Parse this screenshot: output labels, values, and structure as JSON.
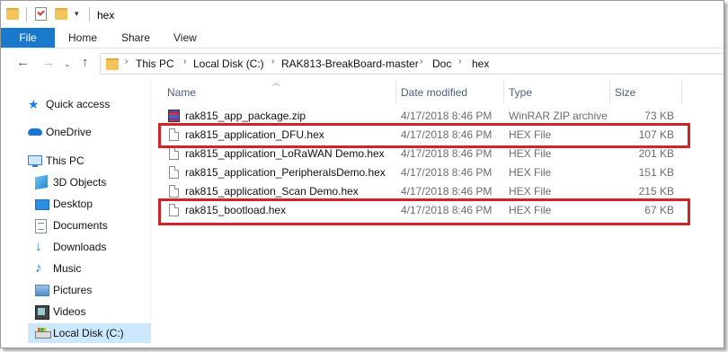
{
  "window": {
    "title": "hex"
  },
  "ribbon": {
    "tabs": [
      "File",
      "Home",
      "Share",
      "View"
    ]
  },
  "address": {
    "crumbs": [
      "This PC",
      "Local Disk (C:)",
      "RAK813-BreakBoard-master",
      "Doc",
      "hex"
    ]
  },
  "nav": {
    "items": [
      {
        "label": "Quick access",
        "icon": "star-icon"
      },
      {
        "label": "OneDrive",
        "icon": "cloud-icon"
      },
      {
        "label": "This PC",
        "icon": "computer-icon"
      },
      {
        "label": "3D Objects",
        "icon": "cube-icon"
      },
      {
        "label": "Desktop",
        "icon": "desktop-icon"
      },
      {
        "label": "Documents",
        "icon": "documents-icon"
      },
      {
        "label": "Downloads",
        "icon": "download-icon"
      },
      {
        "label": "Music",
        "icon": "music-icon"
      },
      {
        "label": "Pictures",
        "icon": "pictures-icon"
      },
      {
        "label": "Videos",
        "icon": "videos-icon"
      },
      {
        "label": "Local Disk (C:)",
        "icon": "drive-icon",
        "selected": true
      }
    ]
  },
  "columns": {
    "name": "Name",
    "date": "Date modified",
    "type": "Type",
    "size": "Size"
  },
  "files": [
    {
      "name": "rak815_app_package.zip",
      "date": "4/17/2018 8:46 PM",
      "type": "WinRAR ZIP archive",
      "size": "73 KB",
      "icon": "zip-archive-icon",
      "highlighted": false
    },
    {
      "name": "rak815_application_DFU.hex",
      "date": "4/17/2018 8:46 PM",
      "type": "HEX File",
      "size": "107 KB",
      "icon": "file-icon",
      "highlighted": true
    },
    {
      "name": "rak815_application_LoRaWAN Demo.hex",
      "date": "4/17/2018 8:46 PM",
      "type": "HEX File",
      "size": "201 KB",
      "icon": "file-icon",
      "highlighted": false
    },
    {
      "name": "rak815_application_PeripheralsDemo.hex",
      "date": "4/17/2018 8:46 PM",
      "type": "HEX File",
      "size": "151 KB",
      "icon": "file-icon",
      "highlighted": false
    },
    {
      "name": "rak815_application_Scan Demo.hex",
      "date": "4/17/2018 8:46 PM",
      "type": "HEX File",
      "size": "215 KB",
      "icon": "file-icon",
      "highlighted": false
    },
    {
      "name": "rak815_bootload.hex",
      "date": "4/17/2018 8:46 PM",
      "type": "HEX File",
      "size": "67 KB",
      "icon": "file-icon",
      "highlighted": true
    }
  ],
  "colors": {
    "accent": "#1979ca",
    "highlight": "#d2232a",
    "selected": "#cce8ff"
  }
}
